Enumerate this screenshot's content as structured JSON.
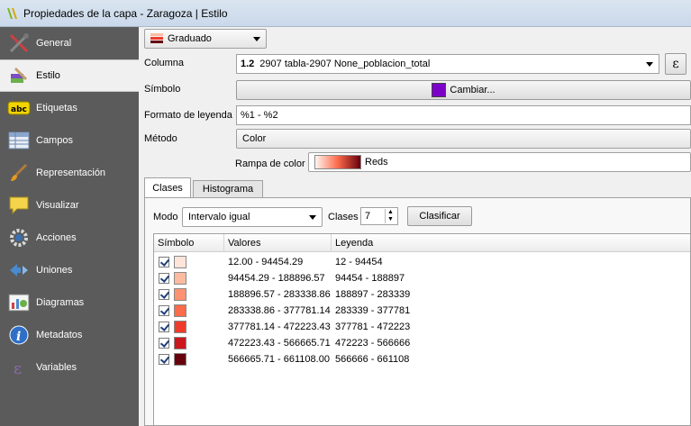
{
  "window": {
    "title": "Propiedades de la capa - Zaragoza | Estilo"
  },
  "sidebar": {
    "items": [
      {
        "label": "General",
        "icon": "tools-icon"
      },
      {
        "label": "Estilo",
        "icon": "paint-icon"
      },
      {
        "label": "Etiquetas",
        "icon": "abc-label-icon"
      },
      {
        "label": "Campos",
        "icon": "table-icon"
      },
      {
        "label": "Representación",
        "icon": "brush-icon"
      },
      {
        "label": "Visualizar",
        "icon": "speech-bubble-icon"
      },
      {
        "label": "Acciones",
        "icon": "gear-icon"
      },
      {
        "label": "Uniones",
        "icon": "join-arrows-icon"
      },
      {
        "label": "Diagramas",
        "icon": "chart-icon"
      },
      {
        "label": "Metadatos",
        "icon": "info-icon"
      },
      {
        "label": "Variables",
        "icon": "epsilon-icon"
      }
    ],
    "active_index": 1
  },
  "renderer": {
    "type": "Graduado"
  },
  "form": {
    "columna_label": "Columna",
    "columna_type": "1.2",
    "columna_value": "2907 tabla-2907 None_poblacion_total",
    "simbolo_label": "Símbolo",
    "simbolo_button": "Cambiar...",
    "simbolo_color": "#7b00c8",
    "formato_label": "Formato de leyenda",
    "formato_value": "%1 - %2",
    "metodo_label": "Método",
    "metodo_value": "Color",
    "rampa_label": "Rampa de color",
    "rampa_value": "Reds",
    "expression_button": "ε"
  },
  "tabs": [
    {
      "label": "Clases"
    },
    {
      "label": "Histograma"
    }
  ],
  "mode": {
    "modo_label": "Modo",
    "modo_value": "Intervalo igual",
    "clases_label": "Clases",
    "clases_value": "7",
    "clasificar_button": "Clasificar"
  },
  "table": {
    "headers": [
      "Símbolo",
      "Valores",
      "Leyenda"
    ],
    "rows": [
      {
        "color": "#fee5d9",
        "values": "12.00 - 94454.29",
        "legend": "12 - 94454"
      },
      {
        "color": "#fcbba1",
        "values": "94454.29 - 188896.57",
        "legend": "94454 - 188897"
      },
      {
        "color": "#fc9272",
        "values": "188896.57 - 283338.86",
        "legend": "188897 - 283339"
      },
      {
        "color": "#fb6a4a",
        "values": "283338.86 - 377781.14",
        "legend": "283339 - 377781"
      },
      {
        "color": "#ef3b2c",
        "values": "377781.14 - 472223.43",
        "legend": "377781 - 472223"
      },
      {
        "color": "#cb181d",
        "values": "472223.43 - 566665.71",
        "legend": "472223 - 566666"
      },
      {
        "color": "#67000d",
        "values": "566665.71 - 661108.00",
        "legend": "566666 - 661108"
      }
    ]
  }
}
